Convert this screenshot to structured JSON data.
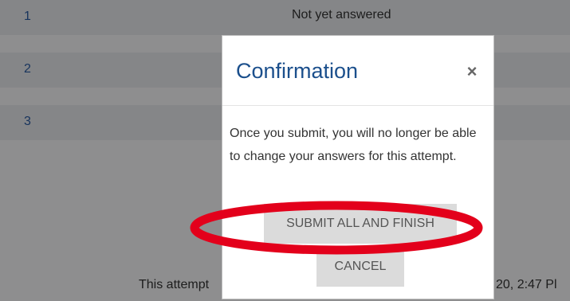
{
  "summary": {
    "rows": [
      {
        "number": "1",
        "status": "Not yet answered"
      },
      {
        "number": "2",
        "status": ""
      },
      {
        "number": "3",
        "status": ""
      }
    ],
    "footer_left": "This attempt",
    "footer_right": "20, 2:47 Pl"
  },
  "modal": {
    "title": "Confirmation",
    "close_symbol": "×",
    "body_text": "Once you submit, you will no longer be able to change your answers for this attempt.",
    "submit_label": "SUBMIT ALL AND FINISH",
    "cancel_label": "CANCEL"
  },
  "colors": {
    "title_blue": "#1b4f8c",
    "annotation_red": "#e3001b",
    "button_gray": "#dbdbdb"
  }
}
